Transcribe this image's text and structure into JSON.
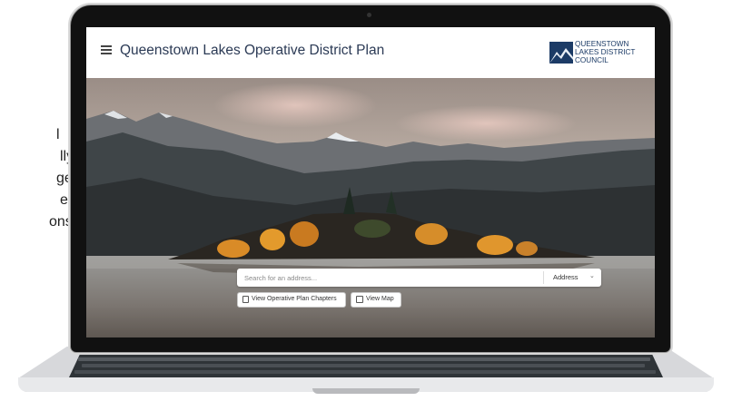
{
  "side_text": [
    "l",
    "lly",
    "ges.",
    "e",
    "ons"
  ],
  "app": {
    "title": "Queenstown Lakes Operative District Plan",
    "menu_icon": "hamburger-menu-icon",
    "logo_lines": [
      "QUEENSTOWN",
      "LAKES DISTRICT",
      "COUNCIL"
    ]
  },
  "search": {
    "placeholder": "Search for an address...",
    "value": "",
    "type_select": "Address",
    "chevron_icon": "chevron-down-icon"
  },
  "actions": {
    "chapters_label": "View Operative Plan Chapters",
    "chapters_icon": "document-icon",
    "map_label": "View Map",
    "map_icon": "map-icon"
  },
  "colors": {
    "title": "#2b3a55",
    "logo": "#1c3b66",
    "laptop_bezel": "#111111"
  }
}
